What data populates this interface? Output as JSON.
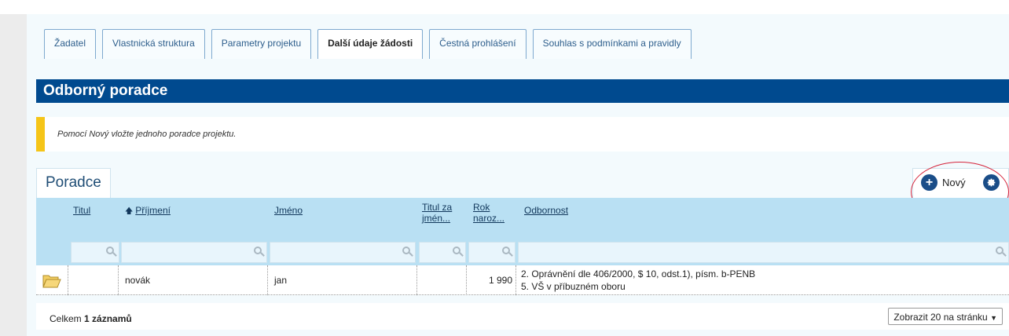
{
  "tabs": [
    {
      "label": "Žadatel",
      "active": false
    },
    {
      "label": "Vlastnická struktura",
      "active": false
    },
    {
      "label": "Parametry projektu",
      "active": false
    },
    {
      "label": "Další údaje žádosti",
      "active": true
    },
    {
      "label": "Čestná prohlášení",
      "active": false
    },
    {
      "label": "Souhlas s podmínkami a pravidly",
      "active": false
    }
  ],
  "section": {
    "title": "Odborný poradce"
  },
  "info": {
    "text": "Pomocí Nový vložte jednoho poradce projektu."
  },
  "grid": {
    "tab_label": "Poradce",
    "new_label": "Nový",
    "new_icon": "plus-circle-icon",
    "settings_icon": "gear-icon",
    "columns": {
      "titul": "Titul",
      "prijmeni": "Příjmení",
      "sort_arrow": "🡅",
      "jmeno": "Jméno",
      "titul_za_l1": "Titul za",
      "titul_za_l2": "jmén...",
      "rok_l1": "Rok",
      "rok_l2": "naroz...",
      "odbornost": "Odbornost"
    },
    "rows": [
      {
        "titul": "",
        "prijmeni": "novák",
        "jmeno": "jan",
        "titul_za": "",
        "rok": "1 990",
        "odbornost_1": "2. Oprávnění dle 406/2000, $ 10, odst.1), písm. b-PENB",
        "odbornost_2": "5. VŠ v příbuzném oboru"
      }
    ],
    "footer": {
      "total_prefix": "Celkem ",
      "total_bold": "1 záznamů",
      "page_size": "Zobrazit 20 na stránku"
    }
  },
  "colors": {
    "header_blue": "#004a8f",
    "accent_yellow": "#f5c518",
    "table_header": "#b9e0f3"
  }
}
